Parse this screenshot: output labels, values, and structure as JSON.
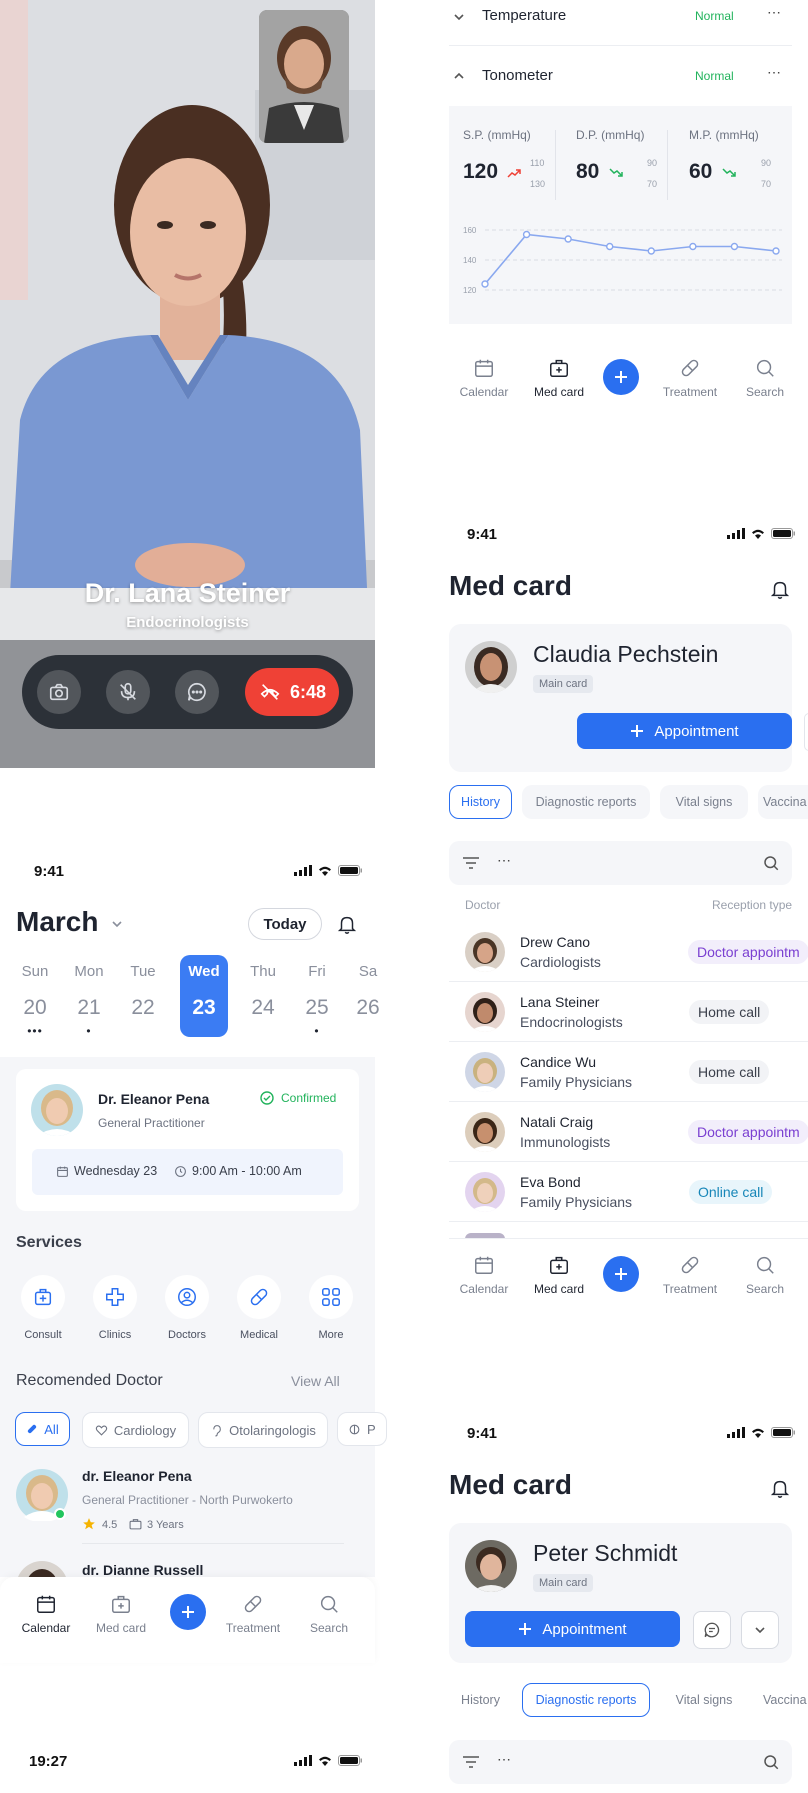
{
  "video_call": {
    "doctor_name": "Dr. Lana Steiner",
    "doctor_specialty": "Endocrinologists",
    "call_timer": "6:48",
    "buttons": [
      "camera-icon",
      "mute-mic-icon",
      "chat-icon",
      "end-call-icon"
    ]
  },
  "vitals": {
    "rows": [
      {
        "label": "Temperature",
        "status": "Normal"
      },
      {
        "label": "Tonometer",
        "status": "Normal"
      }
    ],
    "sp": {
      "label": "S.P. (mmHq)",
      "value": "120",
      "high": "110",
      "low": "130"
    },
    "dp": {
      "label": "D.P. (mmHq)",
      "value": "80",
      "high": "90",
      "low": "70"
    },
    "mp": {
      "label": "M.P. (mmHq)",
      "value": "60",
      "high": "90",
      "low": "70"
    },
    "chart_data": {
      "type": "line",
      "yticks": [
        "160",
        "140",
        "120"
      ],
      "ylim": [
        120,
        160
      ],
      "values": [
        124,
        157,
        154,
        149,
        146,
        149,
        149,
        146
      ],
      "color": "#8aa8ef"
    }
  },
  "nav": {
    "calendar": "Calendar",
    "medcard": "Med card",
    "treatment": "Treatment",
    "search": "Search"
  },
  "status_times": {
    "a": "9:41",
    "b": "9:41",
    "c": "9:41",
    "d": "19:27"
  },
  "calendar": {
    "month": "March",
    "today": "Today",
    "days": [
      {
        "name": "Sun",
        "num": "20",
        "dots": "•••"
      },
      {
        "name": "Mon",
        "num": "21",
        "dots": "•"
      },
      {
        "name": "Tue",
        "num": "22",
        "dots": ""
      },
      {
        "name": "Wed",
        "num": "23",
        "dots": ""
      },
      {
        "name": "Thu",
        "num": "24",
        "dots": ""
      },
      {
        "name": "Fri",
        "num": "25",
        "dots": "•"
      },
      {
        "name": "Sa",
        "num": "26",
        "dots": ""
      }
    ],
    "appointment": {
      "doctor": "Dr. Eleanor Pena",
      "specialty": "General Practitioner",
      "status": "Confirmed",
      "date": "Wednesday 23",
      "time": "9:00 Am - 10:00 Am"
    }
  },
  "services": {
    "title": "Services",
    "items": [
      "Consult",
      "Clinics",
      "Doctors",
      "Medical",
      "More"
    ]
  },
  "recommended": {
    "title": "Recomended Doctor",
    "view_all": "View All",
    "filters": [
      "All",
      "Cardiology",
      "Otolaringologis",
      "P"
    ],
    "doctors": [
      {
        "name": "dr. Eleanor Pena",
        "detail": "General Practitioner - North Purwokerto",
        "rating": "4.5",
        "years": "3 Years"
      },
      {
        "name": "dr. Dianne Russell"
      }
    ]
  },
  "medcard1": {
    "title": "Med card",
    "patient": "Claudia Pechstein",
    "main_card": "Main card",
    "appointment": "Appointment",
    "tabs": [
      "History",
      "Diagnostic reports",
      "Vital signs",
      "Vaccina"
    ],
    "col_doctor": "Doctor",
    "col_type": "Reception type",
    "rows": [
      {
        "name": "Drew Cano",
        "spec": "Cardiologists",
        "type": "Doctor appointm",
        "style": "purple"
      },
      {
        "name": "Lana Steiner",
        "spec": "Endocrinologists",
        "type": "Home call",
        "style": "gray"
      },
      {
        "name": "Candice Wu",
        "spec": "Family Physicians",
        "type": "Home call",
        "style": "gray"
      },
      {
        "name": "Natali Craig",
        "spec": "Immunologists",
        "type": "Doctor appointm",
        "style": "purple"
      },
      {
        "name": "Eva Bond",
        "spec": "Family Physicians",
        "type": "Online call",
        "style": "cyan"
      }
    ]
  },
  "medcard2": {
    "title": "Med card",
    "patient": "Peter Schmidt",
    "main_card": "Main card",
    "appointment": "Appointment",
    "tabs": [
      "History",
      "Diagnostic reports",
      "Vital signs",
      "Vaccina"
    ]
  }
}
